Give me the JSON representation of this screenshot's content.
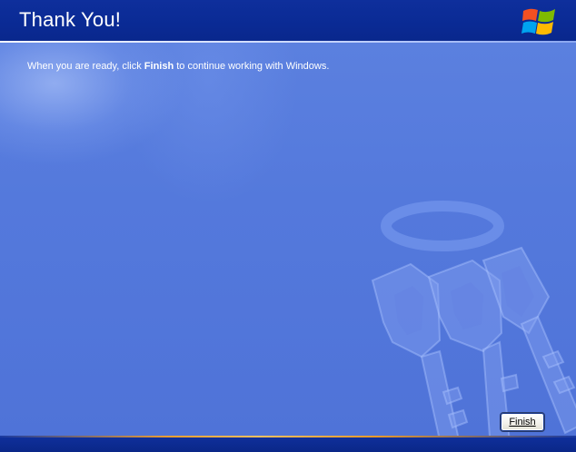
{
  "header": {
    "title": "Thank You!",
    "logo_icon": "windows-flag-logo"
  },
  "main": {
    "message_before": "When you are ready, click ",
    "message_bold": "Finish",
    "message_after": " to continue working with Windows.",
    "decoration_icon": "keys-watermark"
  },
  "buttons": {
    "finish_label": "Finish"
  },
  "colors": {
    "header_bg": "#0a2a94",
    "panel_bg": "#5a7edc",
    "footer_accent": "#f0a030",
    "text": "#ffffff"
  }
}
